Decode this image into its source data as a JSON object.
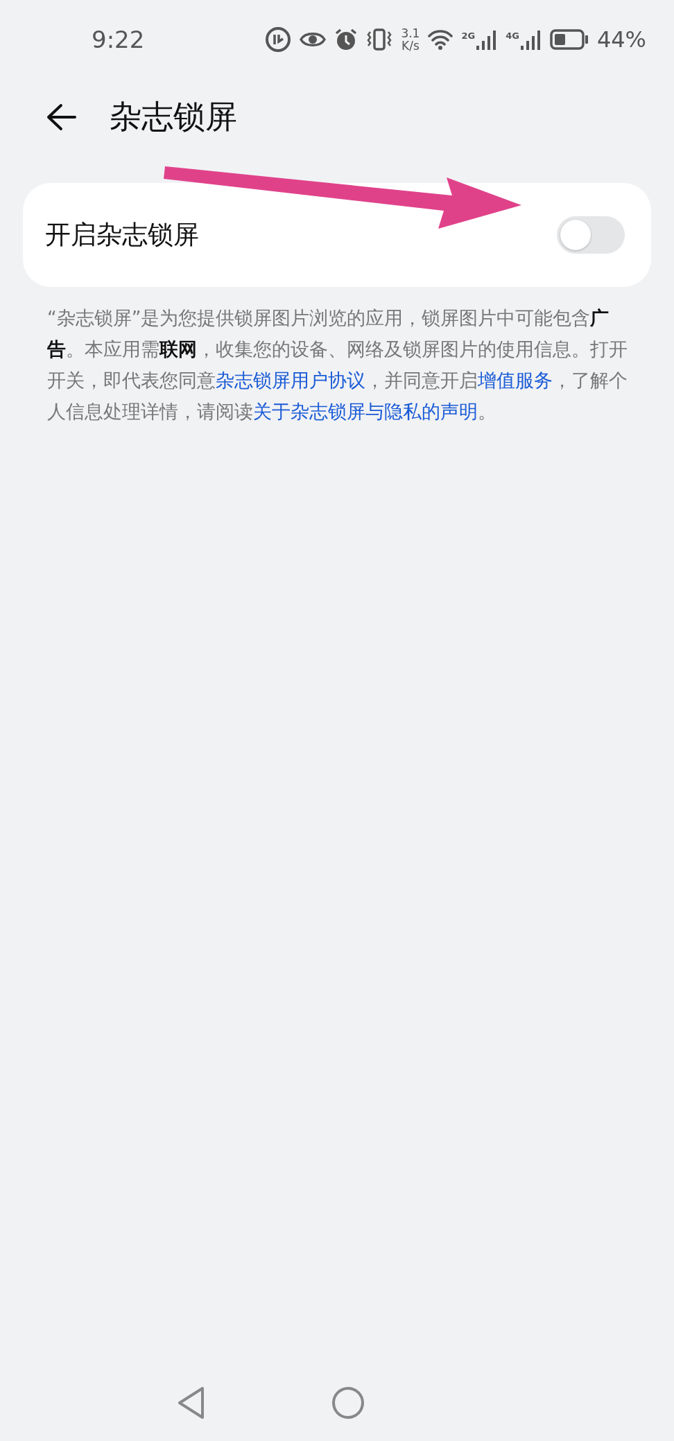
{
  "status_bar": {
    "time": "9:22",
    "speed": [
      "3.1",
      "K/s"
    ],
    "sim_1": "2G",
    "sim_2": "4G",
    "battery": "44%"
  },
  "header": {
    "title": "杂志锁屏"
  },
  "setting": {
    "label": "开启杂志锁屏",
    "on": false
  },
  "description": [
    {
      "kind": "plain",
      "text": "“杂志锁屏”是为您提供锁屏图片浏览的应用，锁屏图片中可能包含"
    },
    {
      "kind": "strong",
      "text": "广告"
    },
    {
      "kind": "plain",
      "text": "。本应用需"
    },
    {
      "kind": "strong",
      "text": "联网"
    },
    {
      "kind": "plain",
      "text": "，收集您的设备、网络及锁屏图片的使用信息。打开开关，即代表您同意"
    },
    {
      "kind": "link",
      "text": "杂志锁屏用户协议"
    },
    {
      "kind": "plain",
      "text": "，并同意开启"
    },
    {
      "kind": "link",
      "text": "增值服务"
    },
    {
      "kind": "plain",
      "text": "，了解个人信息处理详情，请阅读"
    },
    {
      "kind": "link",
      "text": "关于杂志锁屏与隐私的声明"
    },
    {
      "kind": "plain",
      "text": "。"
    }
  ]
}
